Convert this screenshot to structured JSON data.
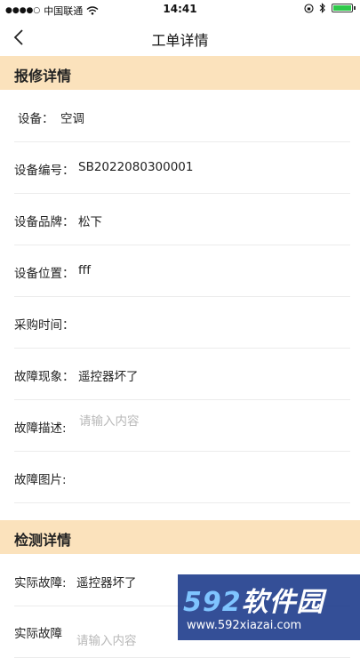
{
  "status": {
    "carrier": "中国联通",
    "time": "14:41"
  },
  "nav": {
    "title": "工单详情"
  },
  "section1": {
    "title": "报修详情",
    "rows": [
      {
        "label": "设备：",
        "value": "空调"
      },
      {
        "label": "设备编号：",
        "value": "SB2022080300001"
      },
      {
        "label": "设备品牌：",
        "value": "松下"
      },
      {
        "label": "设备位置：",
        "value": "fff"
      },
      {
        "label": "采购时间：",
        "value": ""
      },
      {
        "label": "故障现象：",
        "value": "遥控器坏了"
      },
      {
        "label": "故障描述:",
        "placeholder": "请输入内容"
      },
      {
        "label": "故障图片:",
        "value": ""
      }
    ]
  },
  "section2": {
    "title": "检测详情",
    "rows": [
      {
        "label": "实际故障:",
        "value": "遥控器坏了"
      },
      {
        "label": "实际故障",
        "placeholder": "请输入内容"
      }
    ]
  },
  "watermark": {
    "brand_num": "592",
    "brand_text": "软件园",
    "url": "www.592xiazai.com"
  },
  "colors": {
    "section_bg": "#fbe2bc",
    "battery": "#2ec94a"
  }
}
